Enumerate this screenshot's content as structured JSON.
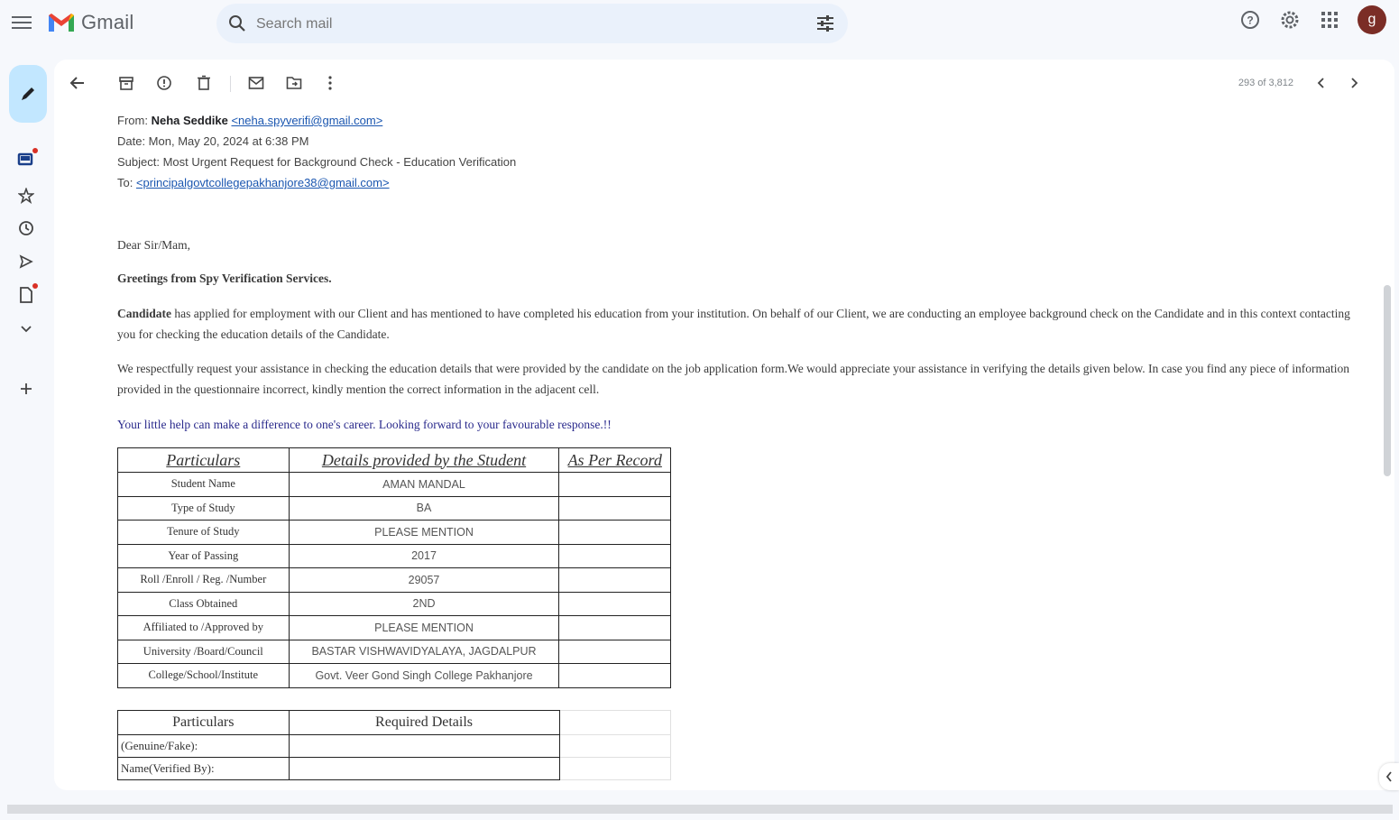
{
  "app": {
    "name": "Gmail"
  },
  "search": {
    "placeholder": "Search mail"
  },
  "header": {
    "avatar_letter": "g"
  },
  "toolbar": {
    "pager": "293 of 3,812"
  },
  "email": {
    "from_label": "From:",
    "from_name": "Neha Seddike",
    "from_email": "<neha.spyverifi@gmail.com>",
    "date_line": "Date: Mon, May 20, 2024 at 6:38 PM",
    "subject_line": "Subject: Most Urgent Request for Background Check - Education Verification",
    "to_label": "To:",
    "to_email": "<principalgovtcollegepakhanjore38@gmail.com>",
    "greeting": "Dear Sir/Mam,",
    "greetings_line": "Greetings from Spy Verification Services.",
    "p1_bold": "Candidate",
    "p1_rest": " has applied for employment with our Client and has mentioned to have completed his education from your institution. On behalf of our Client, we are conducting an employee background check on the Candidate and in this context contacting you for checking the education details of the Candidate.",
    "p2": "We respectfully request your assistance in checking the education details that were provided by the candidate on the job application form.We would appreciate your assistance in verifying the details given below. In case you find any piece of information provided in the questionnaire incorrect, kindly mention the correct information in the adjacent cell.",
    "p3": "Your little help can make a difference to one's career. Looking forward to your favourable response.!!"
  },
  "table1": {
    "headers": [
      "Particulars",
      "Details provided by the Student",
      "As Per Record"
    ],
    "rows": [
      [
        "Student Name",
        "AMAN MANDAL",
        ""
      ],
      [
        "Type of Study",
        "BA",
        ""
      ],
      [
        "Tenure of Study",
        "PLEASE MENTION",
        ""
      ],
      [
        "Year of Passing",
        "2017",
        ""
      ],
      [
        "Roll /Enroll / Reg. /Number",
        "29057",
        ""
      ],
      [
        "Class Obtained",
        "2ND",
        ""
      ],
      [
        "Affiliated to /Approved by",
        "PLEASE MENTION",
        ""
      ],
      [
        "University /Board/Council",
        "BASTAR VISHWAVIDYALAYA, JAGDALPUR",
        ""
      ],
      [
        "College/School/Institute",
        "Govt. Veer Gond Singh College Pakhanjore",
        ""
      ]
    ]
  },
  "table2": {
    "headers": [
      "Particulars",
      "Required Details",
      ""
    ],
    "rows": [
      [
        "(Genuine/Fake):",
        "",
        ""
      ],
      [
        "Name(Verified By):",
        "",
        ""
      ]
    ]
  }
}
